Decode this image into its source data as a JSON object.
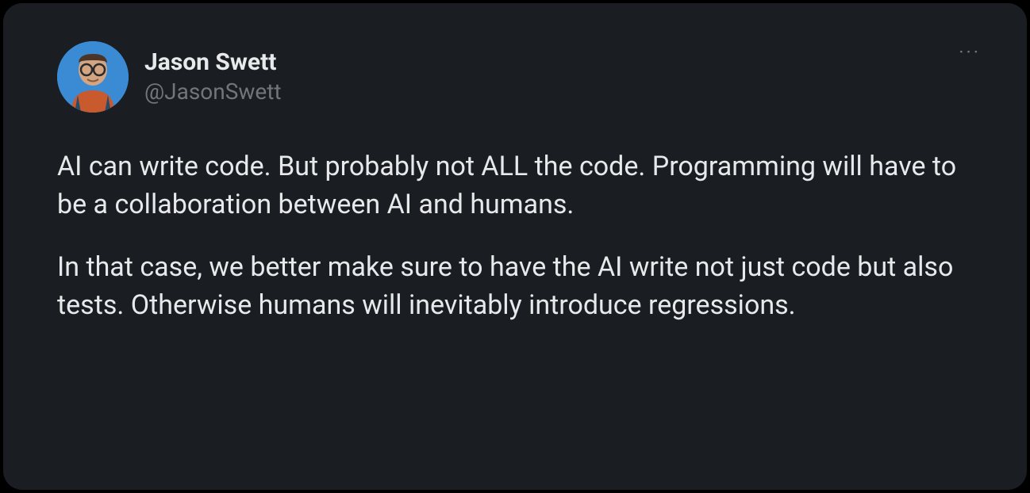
{
  "user": {
    "display_name": "Jason Swett",
    "handle": "@JasonSwett"
  },
  "tweet": {
    "paragraph1": "AI can write code. But probably not ALL the code. Programming will have to be a collaboration between AI and humans.",
    "paragraph2": "In that case, we better make sure to have the AI write not just code but also tests. Otherwise humans will inevitably introduce regressions."
  },
  "icons": {
    "more": "···"
  }
}
